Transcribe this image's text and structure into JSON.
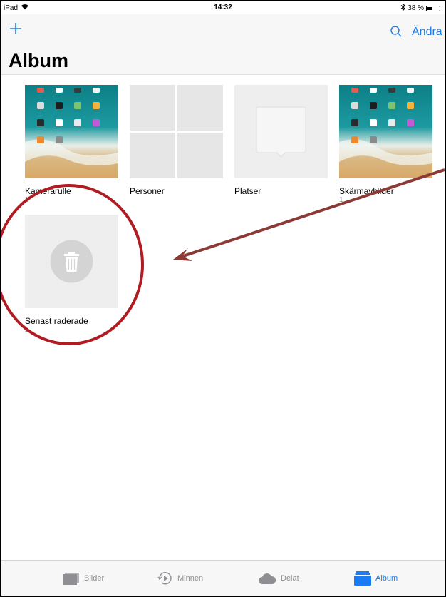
{
  "status": {
    "device": "iPad",
    "time": "14:32",
    "battery": "38 %",
    "battery_level": 0.38
  },
  "nav": {
    "edit_label": "Ändra",
    "title": "Album"
  },
  "albums": [
    {
      "label": "Kamerarulle",
      "count": "1"
    },
    {
      "label": "Personer",
      "count": ""
    },
    {
      "label": "Platser",
      "count": ""
    },
    {
      "label": "Skärmavbilder",
      "count": "1"
    },
    {
      "label": "Senast raderade",
      "count": "2"
    }
  ],
  "tabs": [
    {
      "label": "Bilder"
    },
    {
      "label": "Minnen"
    },
    {
      "label": "Delat"
    },
    {
      "label": "Album"
    }
  ],
  "colors": {
    "accent": "#1a7cf2",
    "annotation": "#b01c22",
    "arrow": "#8b3a35"
  }
}
